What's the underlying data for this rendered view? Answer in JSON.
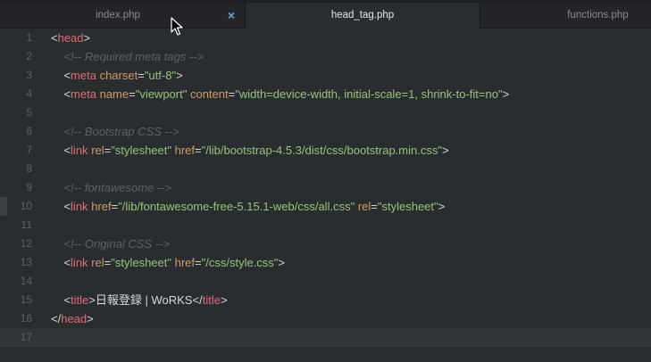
{
  "tabs": [
    {
      "label": "index.php",
      "active": false,
      "has_close": true
    },
    {
      "label": "head_tag.php",
      "active": true,
      "has_close": false
    },
    {
      "label": "functions.php",
      "active": false,
      "has_close": false
    }
  ],
  "close_icon": "×",
  "current_line": 17,
  "colors": {
    "tag": "#e06c75",
    "attribute": "#d19a66",
    "string": "#98c379",
    "comment": "#5c6166",
    "text": "#d5d8da",
    "background": "#2a2d30"
  },
  "lines": [
    {
      "n": "1",
      "indent": "",
      "tokens": [
        [
          "punc",
          "<"
        ],
        [
          "tag",
          "head"
        ],
        [
          "punc",
          ">"
        ]
      ]
    },
    {
      "n": "2",
      "indent": "    ",
      "tokens": [
        [
          "com",
          "<!-- Required meta tags -->"
        ]
      ]
    },
    {
      "n": "3",
      "indent": "    ",
      "tokens": [
        [
          "punc",
          "<"
        ],
        [
          "tag",
          "meta"
        ],
        [
          "text",
          " "
        ],
        [
          "attr",
          "charset"
        ],
        [
          "punc",
          "="
        ],
        [
          "str",
          "\"utf-8\""
        ],
        [
          "punc",
          ">"
        ]
      ]
    },
    {
      "n": "4",
      "indent": "    ",
      "tokens": [
        [
          "punc",
          "<"
        ],
        [
          "tag",
          "meta"
        ],
        [
          "text",
          " "
        ],
        [
          "attr",
          "name"
        ],
        [
          "punc",
          "="
        ],
        [
          "str",
          "\"viewport\""
        ],
        [
          "text",
          " "
        ],
        [
          "attr",
          "content"
        ],
        [
          "punc",
          "="
        ],
        [
          "str",
          "\"width=device-width, initial-scale=1, shrink-to-fit=no\""
        ],
        [
          "punc",
          ">"
        ]
      ]
    },
    {
      "n": "5",
      "indent": "",
      "tokens": []
    },
    {
      "n": "6",
      "indent": "    ",
      "tokens": [
        [
          "com",
          "<!-- Bootstrap CSS -->"
        ]
      ]
    },
    {
      "n": "7",
      "indent": "    ",
      "tokens": [
        [
          "punc",
          "<"
        ],
        [
          "tag",
          "link"
        ],
        [
          "text",
          " "
        ],
        [
          "attr",
          "rel"
        ],
        [
          "punc",
          "="
        ],
        [
          "str",
          "\"stylesheet\""
        ],
        [
          "text",
          " "
        ],
        [
          "attr",
          "href"
        ],
        [
          "punc",
          "="
        ],
        [
          "str",
          "\"/lib/bootstrap-4.5.3/dist/css/bootstrap.min.css\""
        ],
        [
          "punc",
          ">"
        ]
      ]
    },
    {
      "n": "8",
      "indent": "",
      "tokens": []
    },
    {
      "n": "9",
      "indent": "    ",
      "tokens": [
        [
          "com",
          "<!-- fontawesome -->"
        ]
      ]
    },
    {
      "n": "10",
      "indent": "    ",
      "tokens": [
        [
          "punc",
          "<"
        ],
        [
          "tag",
          "link"
        ],
        [
          "text",
          " "
        ],
        [
          "attr",
          "href"
        ],
        [
          "punc",
          "="
        ],
        [
          "str",
          "\"/lib/fontawesome-free-5.15.1-web/css/all.css\""
        ],
        [
          "text",
          " "
        ],
        [
          "attr",
          "rel"
        ],
        [
          "punc",
          "="
        ],
        [
          "str",
          "\"stylesheet\""
        ],
        [
          "punc",
          ">"
        ]
      ]
    },
    {
      "n": "11",
      "indent": "",
      "tokens": []
    },
    {
      "n": "12",
      "indent": "    ",
      "tokens": [
        [
          "com",
          "<!-- Original CSS -->"
        ]
      ]
    },
    {
      "n": "13",
      "indent": "    ",
      "tokens": [
        [
          "punc",
          "<"
        ],
        [
          "tag",
          "link"
        ],
        [
          "text",
          " "
        ],
        [
          "attr",
          "rel"
        ],
        [
          "punc",
          "="
        ],
        [
          "str",
          "\"stylesheet\""
        ],
        [
          "text",
          " "
        ],
        [
          "attr",
          "href"
        ],
        [
          "punc",
          "="
        ],
        [
          "str",
          "\"/css/style.css\""
        ],
        [
          "punc",
          ">"
        ]
      ]
    },
    {
      "n": "14",
      "indent": "",
      "tokens": []
    },
    {
      "n": "15",
      "indent": "    ",
      "tokens": [
        [
          "punc",
          "<"
        ],
        [
          "tag",
          "title"
        ],
        [
          "punc",
          ">"
        ],
        [
          "text",
          "日報登録 | WoRKS"
        ],
        [
          "punc",
          "</"
        ],
        [
          "tag",
          "title"
        ],
        [
          "punc",
          ">"
        ]
      ]
    },
    {
      "n": "16",
      "indent": "",
      "tokens": [
        [
          "punc",
          "</"
        ],
        [
          "tag",
          "head"
        ],
        [
          "punc",
          ">"
        ]
      ]
    },
    {
      "n": "17",
      "indent": "",
      "tokens": []
    }
  ]
}
